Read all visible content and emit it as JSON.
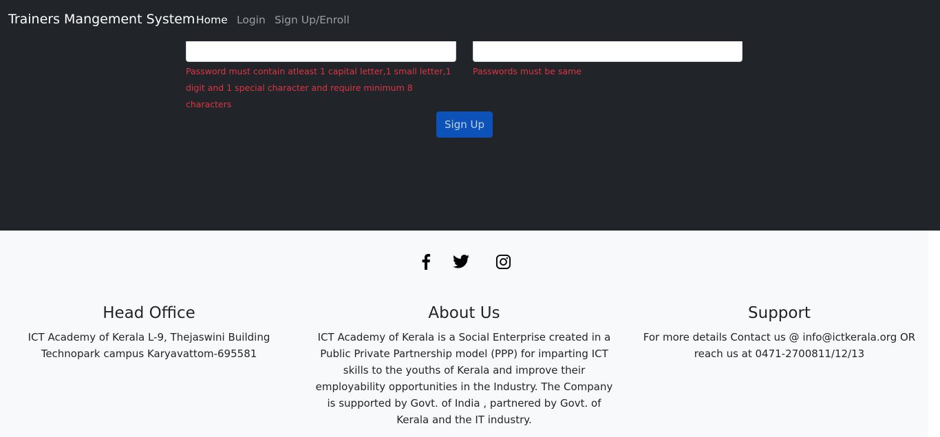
{
  "navbar": {
    "brand": "Trainers Mangement System",
    "links": [
      {
        "label": "Home",
        "active": true
      },
      {
        "label": "Login",
        "active": false
      },
      {
        "label": "Sign Up/Enroll",
        "active": false
      }
    ]
  },
  "form": {
    "password_error": "Password must contain atleast 1 capital letter,1 small letter,1 digit and 1 special character and require minimum 8 characters",
    "confirm_error": "Passwords must be same",
    "submit_label": "Sign Up"
  },
  "footer": {
    "social": [
      "facebook-icon",
      "twitter-icon",
      "instagram-icon"
    ],
    "head_office": {
      "title": "Head Office",
      "text": "ICT Academy of Kerala L-9, Thejaswini Building Technopark campus Karyavattom-695581"
    },
    "about": {
      "title": "About Us",
      "text": "ICT Academy of Kerala is a Social Enterprise created in a Public Private Partnership model (PPP) for imparting ICT skills to the youths of Kerala and improve their employability opportunities in the Industry. The Company is supported by Govt. of India , partnered by Govt. of Kerala and the IT industry."
    },
    "support": {
      "title": "Support",
      "text": "For more details Contact us @ info@ictkerala.org OR reach us at 0471-2700811/12/13"
    }
  },
  "colors": {
    "dark_bg": "#212529",
    "error": "#dc3545",
    "primary": "#0d52b9",
    "footer_bg": "#f8f9fa"
  }
}
